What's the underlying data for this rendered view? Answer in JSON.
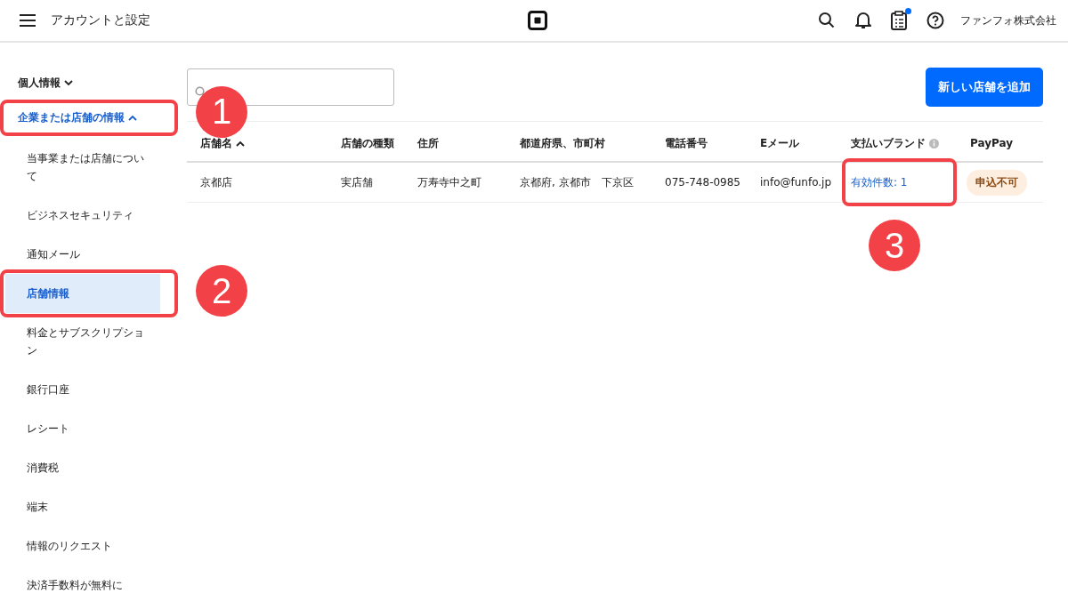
{
  "header": {
    "title": "アカウントと設定",
    "notification_dot": true,
    "account": "ファンフォ株式会社"
  },
  "sidebar": {
    "items": [
      {
        "kind": "section",
        "label": "個人情報",
        "expanded": false
      },
      {
        "kind": "section",
        "label": "企業または店舗の情報",
        "expanded": true,
        "callout": "1"
      },
      {
        "kind": "link",
        "label": "当事業または店舗について",
        "selected": false
      },
      {
        "kind": "link",
        "label": "ビジネスセキュリティ",
        "selected": false
      },
      {
        "kind": "link",
        "label": "通知メール",
        "selected": false
      },
      {
        "kind": "link",
        "label": "店舗情報",
        "selected": true,
        "callout": "2"
      },
      {
        "kind": "link",
        "label": "料金とサブスクリプション",
        "selected": false
      },
      {
        "kind": "link",
        "label": "銀行口座",
        "selected": false
      },
      {
        "kind": "link",
        "label": "レシート",
        "selected": false
      },
      {
        "kind": "link",
        "label": "消費税",
        "selected": false
      },
      {
        "kind": "link",
        "label": "端末",
        "selected": false
      },
      {
        "kind": "link",
        "label": "情報のリクエスト",
        "selected": false
      },
      {
        "kind": "link",
        "label": "決済手数料が無料に",
        "selected": false
      }
    ]
  },
  "toolbar": {
    "add_button": "新しい店舗を追加"
  },
  "table": {
    "columns": [
      {
        "label": "店舗名",
        "sorted": true,
        "info": false
      },
      {
        "label": "店舗の種類",
        "sorted": false,
        "info": false
      },
      {
        "label": "住所",
        "sorted": false,
        "info": false
      },
      {
        "label": "都道府県、市町村",
        "sorted": false,
        "info": false
      },
      {
        "label": "電話番号",
        "sorted": false,
        "info": false
      },
      {
        "label": "Eメール",
        "sorted": false,
        "info": false
      },
      {
        "label": "支払いブランド",
        "sorted": false,
        "info": true
      },
      {
        "label": "PayPay",
        "sorted": false,
        "info": false
      }
    ],
    "rows": [
      {
        "cells": [
          {
            "kind": "text",
            "text": "京都店"
          },
          {
            "kind": "text",
            "text": "実店舗"
          },
          {
            "kind": "text",
            "text": "万寿寺中之町"
          },
          {
            "kind": "text",
            "text": "京都府, 京都市　下京区"
          },
          {
            "kind": "text",
            "text": "075-748-0985"
          },
          {
            "kind": "text",
            "text": "info@funfo.jp"
          },
          {
            "kind": "link",
            "text": "有効件数: 1",
            "callout": "3"
          },
          {
            "kind": "tag",
            "text": "申込不可"
          }
        ]
      }
    ]
  }
}
